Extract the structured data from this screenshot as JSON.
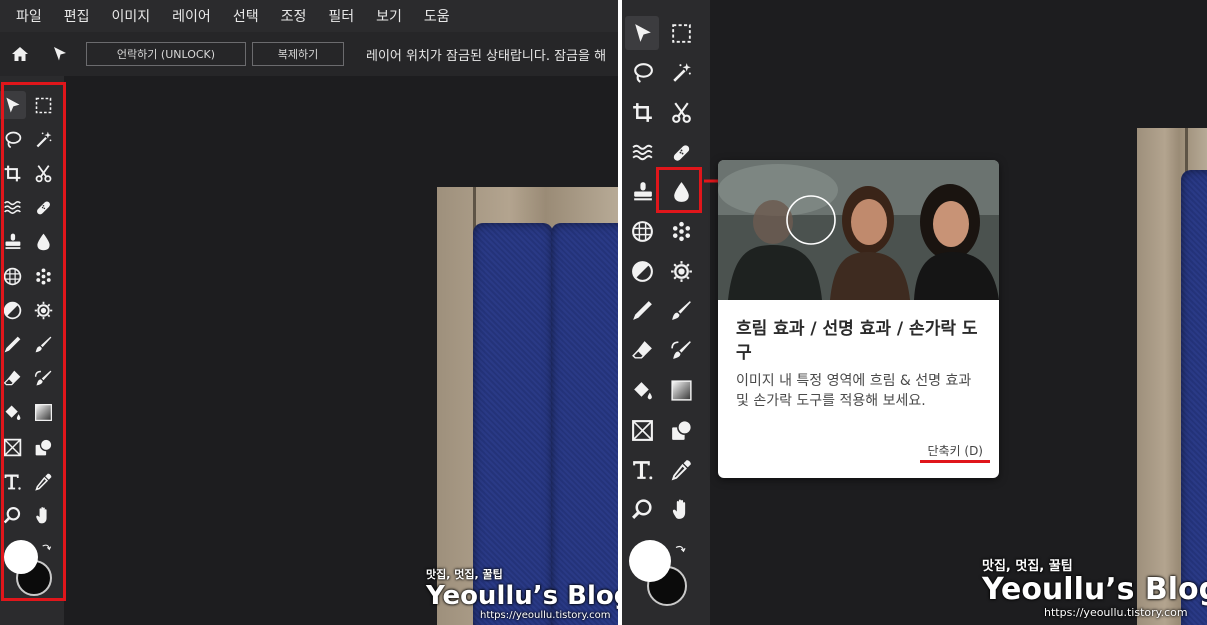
{
  "left": {
    "menu": [
      "파일",
      "편집",
      "이미지",
      "레이어",
      "선택",
      "조정",
      "필터",
      "보기",
      "도움"
    ],
    "options_bar": {
      "home_icon": "home-icon",
      "move_icon": "move-arrow-icon",
      "unlock_label": "언락하기 (UNLOCK)",
      "duplicate_label": "복제하기",
      "message": "레이어 위치가 잠금된 상태랍니다. 잠금을 해"
    }
  },
  "right": {
    "tooltip": {
      "title": "흐림 효과 / 선명 효과 / 손가락 도구",
      "description": "이미지 내 특정 영역에 흐림 & 선명 효과 및 손가락 도구를 적용해 보세요.",
      "shortcut": "단축키 (D)"
    }
  },
  "watermark": {
    "sub": "맛집, 멋집, 꿀팁",
    "title": "Yeoullu’s Blog",
    "url": "https://yeoullu.tistory.com"
  },
  "toolbar_icons": [
    [
      "move-icon",
      "marquee-icon"
    ],
    [
      "lasso-icon",
      "magic-wand-icon"
    ],
    [
      "crop-icon",
      "scissors-icon"
    ],
    [
      "liquify-icon",
      "healing-bandage-icon"
    ],
    [
      "clone-stamp-icon",
      "blur-drop-icon"
    ],
    [
      "pattern-icon",
      "spot-dots-icon"
    ],
    [
      "dodge-burn-icon",
      "sponge-icon"
    ],
    [
      "pencil-icon",
      "brush-icon"
    ],
    [
      "eraser-icon",
      "color-replace-icon"
    ],
    [
      "paint-bucket-icon",
      "gradient-icon"
    ],
    [
      "frame-icon",
      "shape-icon"
    ],
    [
      "text-icon",
      "eyedropper-icon"
    ],
    [
      "zoom-icon",
      "hand-icon"
    ]
  ],
  "colors": {
    "highlight": "#e0161b",
    "panel_bg": "#1d1d1f",
    "toolbar_bg": "#2b2b2d",
    "notebook": "#2a3a86",
    "foreground": "#ffffff",
    "background": "#0b0b0b"
  }
}
